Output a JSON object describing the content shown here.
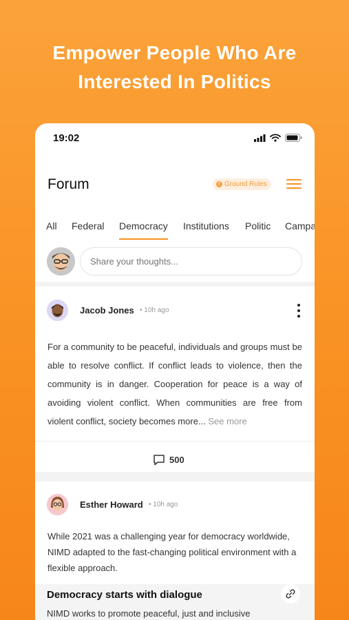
{
  "promo": {
    "headline_line1": "Empower People Who Are",
    "headline_line2": "Interested In Politics"
  },
  "status_bar": {
    "time": "19:02",
    "icons": [
      "cellular-signal-icon",
      "wifi-icon",
      "battery-icon"
    ]
  },
  "header": {
    "title": "Forum",
    "ground_rules_label": "Ground Rules",
    "ground_rules_icon": "info-icon",
    "menu_icon": "hamburger-menu-icon"
  },
  "tabs": [
    {
      "label": "All",
      "active": false
    },
    {
      "label": "Federal",
      "active": false
    },
    {
      "label": "Democracy",
      "active": true
    },
    {
      "label": "Institutions",
      "active": false
    },
    {
      "label": "Politic",
      "active": false
    },
    {
      "label": "Campa",
      "active": false
    }
  ],
  "composer": {
    "placeholder": "Share your thoughts..."
  },
  "posts": [
    {
      "author": "Jacob Jones",
      "time": "10h ago",
      "body": "For a community to be peaceful, individuals and groups must be able to resolve conflict. If conflict leads to violence, then the community is in danger. Cooperation for peace is a way of avoiding violent conflict. When communities are free from violent conflict, society becomes more...",
      "see_more": "See more",
      "comment_count": "500"
    },
    {
      "author": "Esther Howard",
      "time": "10h ago",
      "body": "While 2021 was a challenging year for democracy worldwide, NIMD adapted to the fast-changing political environment with a flexible approach.",
      "link_title": "Democracy starts with dialogue",
      "link_desc": "NIMD works to promote peaceful, just and inclusive"
    }
  ],
  "colors": {
    "accent": "#f7921e",
    "background_gradient_top": "#fba33a",
    "background_gradient_bottom": "#f7861a"
  }
}
